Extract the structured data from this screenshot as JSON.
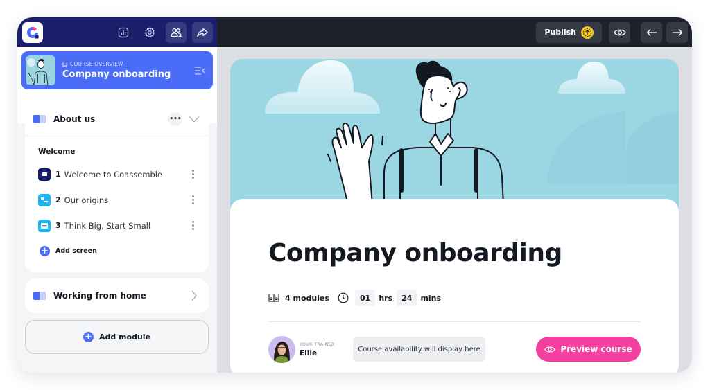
{
  "sidebar": {
    "top_icons": [
      "analytics-icon",
      "settings-icon",
      "users-icon",
      "share-icon"
    ],
    "overview": {
      "kicker": "COURSE OVERVIEW",
      "title": "Company onboarding"
    },
    "modules": [
      {
        "title": "About us",
        "expanded": true,
        "section": "Welcome",
        "screens": [
          {
            "number": "1",
            "label": "Welcome to Coassemble",
            "icon_color": "#1a1f6b"
          },
          {
            "number": "2",
            "label": "Our origins",
            "icon_color": "#1fb6ef"
          },
          {
            "number": "3",
            "label": "Think Big, Start Small",
            "icon_color": "#1fb6ef"
          }
        ],
        "add_screen_label": "Add screen"
      },
      {
        "title": "Working from home",
        "expanded": false
      }
    ],
    "add_module_label": "Add module"
  },
  "topbar": {
    "publish_label": "Publish"
  },
  "course": {
    "title": "Company onboarding",
    "modules_count": "4 modules",
    "duration_hours": "01",
    "hours_label": "hrs",
    "duration_mins": "24",
    "mins_label": "mins",
    "trainer_label": "YOUR TRAINER",
    "trainer_name": "Ellie",
    "availability_text": "Course availability will display here",
    "preview_label": "Preview course"
  },
  "colors": {
    "brand_navy": "#1a1f6b",
    "accent_blue": "#4a6cf7",
    "preview_pink": "#f53fa1",
    "publish_yellow": "#f5c526",
    "hero_sky": "#9bd6e3"
  }
}
